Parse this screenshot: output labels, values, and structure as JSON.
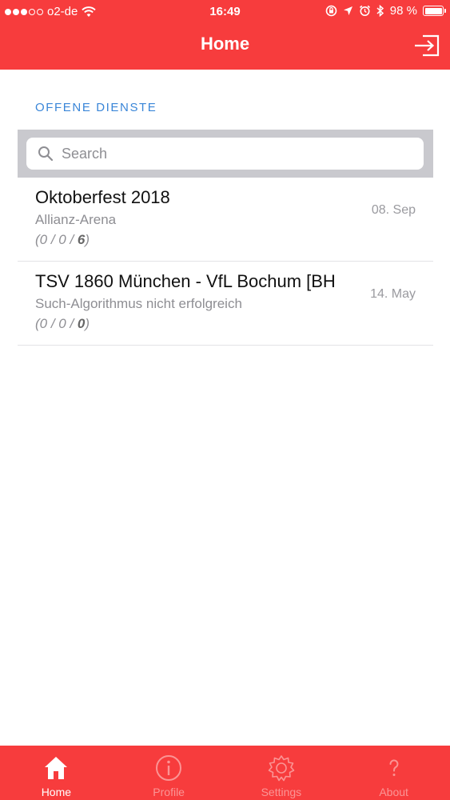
{
  "status": {
    "carrier": "o2-de",
    "time": "16:49",
    "battery": "98 %"
  },
  "nav": {
    "title": "Home",
    "logout_icon": "logout-arrow-icon"
  },
  "section": {
    "header": "OFFENE DIENSTE"
  },
  "search": {
    "placeholder": "Search",
    "value": ""
  },
  "services": [
    {
      "title": "Oktoberfest 2018",
      "subtitle": "Allianz-Arena",
      "counts_prefix": "(0 / 0 / ",
      "counts_last": "6",
      "counts_suffix": ")",
      "date": "08. Sep"
    },
    {
      "title": "TSV 1860 München - VfL Bochum [BH",
      "subtitle": "Such-Algorithmus nicht erfolgreich",
      "counts_prefix": "(0 / 0 / ",
      "counts_last": "0",
      "counts_suffix": ")",
      "date": "14. May"
    }
  ],
  "tabbar": {
    "tabs": [
      {
        "label": "Home",
        "icon": "home-icon",
        "active": true
      },
      {
        "label": "Profile",
        "icon": "info-icon",
        "active": false
      },
      {
        "label": "Settings",
        "icon": "gear-icon",
        "active": false
      },
      {
        "label": "About",
        "icon": "question-icon",
        "active": false
      }
    ]
  },
  "colors": {
    "brand": "#f73c3d",
    "section_header": "#3a86d8",
    "search_bar_bg": "#c9c9ce"
  }
}
